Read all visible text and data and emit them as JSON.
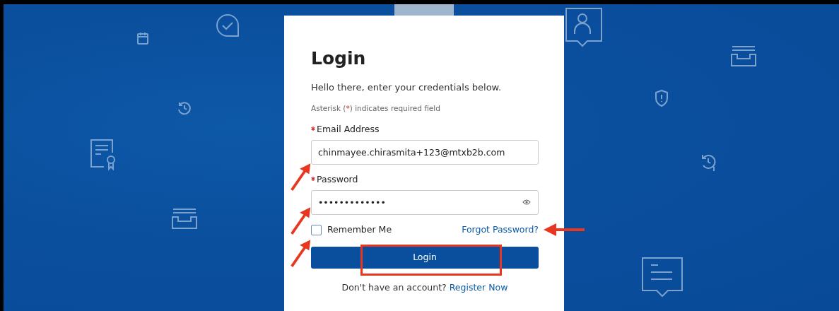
{
  "form": {
    "title": "Login",
    "greeting": "Hello there, enter your credentials below.",
    "required_note": [
      {
        "kind": "text",
        "text": "Asterisk ("
      },
      {
        "kind": "mark",
        "text": "*"
      },
      {
        "kind": "text",
        "text": ") indicates required field"
      }
    ],
    "fields": [
      {
        "label": "Email Address",
        "required": true,
        "kind": "text",
        "value": "chinmayee.chirasmita+123@mtxb2b.com"
      },
      {
        "label": "Password",
        "required": true,
        "kind": "password",
        "value": "•••••••••••••"
      }
    ],
    "remember": {
      "label": "Remember Me",
      "checked": false
    },
    "forgot_link": "Forgot Password?",
    "submit": "Login",
    "register_prompt": "Don't have an account?",
    "register_link": "Register Now"
  }
}
